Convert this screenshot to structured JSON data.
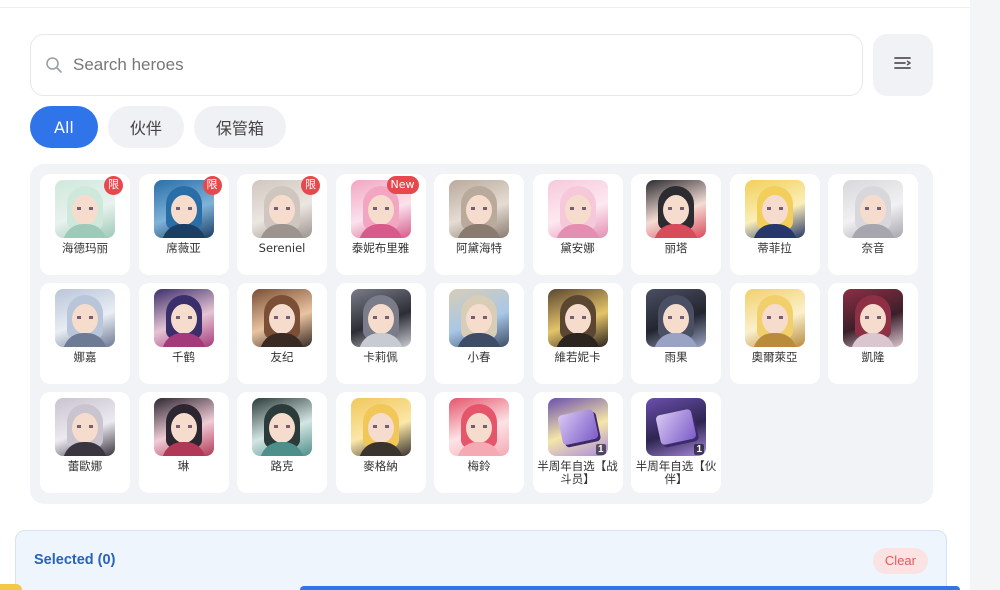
{
  "search": {
    "placeholder": "Search heroes",
    "icon": "search-icon"
  },
  "sort": {
    "icon": "sort-icon"
  },
  "tabs": [
    {
      "label": "All",
      "active": true
    },
    {
      "label": "伙伴",
      "active": false
    },
    {
      "label": "保管箱",
      "active": false
    }
  ],
  "heroes": [
    {
      "name": "海德玛丽",
      "badge": "限",
      "colors": [
        "#cfe8dc",
        "#9fc9b8",
        "#e8f2ee"
      ]
    },
    {
      "name": "席薇亚",
      "badge": "限",
      "colors": [
        "#2a6ea8",
        "#1c3e64",
        "#7fb3d8"
      ]
    },
    {
      "name": "Sereniel",
      "badge": "限",
      "colors": [
        "#cfc7bf",
        "#9d9490",
        "#ece6e1"
      ]
    },
    {
      "name": "泰妮布里雅",
      "badge": "New",
      "colors": [
        "#f2a6c1",
        "#d65b8b",
        "#fbe2ec"
      ]
    },
    {
      "name": "阿黛海特",
      "badge": "",
      "colors": [
        "#b9aa9c",
        "#8a7b70",
        "#e5dcd3"
      ]
    },
    {
      "name": "黛安娜",
      "badge": "",
      "colors": [
        "#f6c9da",
        "#e48eb1",
        "#fde9f0"
      ]
    },
    {
      "name": "丽塔",
      "badge": "",
      "colors": [
        "#2b2b30",
        "#d84b5b",
        "#f4dcd4"
      ]
    },
    {
      "name": "蒂菲拉",
      "badge": "",
      "colors": [
        "#f2cf5a",
        "#27376b",
        "#fbeeb8"
      ]
    },
    {
      "name": "奈音",
      "badge": "",
      "colors": [
        "#d8d8dc",
        "#a7a6ae",
        "#f1f1f3"
      ]
    },
    {
      "name": "娜嘉",
      "badge": "",
      "colors": [
        "#b9c5d9",
        "#6e7b96",
        "#e9edf4"
      ]
    },
    {
      "name": "千鹤",
      "badge": "",
      "colors": [
        "#3b2f6b",
        "#a43a7b",
        "#e6c4d4"
      ]
    },
    {
      "name": "友纪",
      "badge": "",
      "colors": [
        "#7a4f35",
        "#3a2a24",
        "#e9c4a2"
      ]
    },
    {
      "name": "卡莉佩",
      "badge": "",
      "colors": [
        "#7a7d89",
        "#c9cbd2",
        "#2c2d35"
      ]
    },
    {
      "name": "小春",
      "badge": "",
      "colors": [
        "#d8cdb6",
        "#3d4d67",
        "#a8c7e7"
      ]
    },
    {
      "name": "維若妮卡",
      "badge": "",
      "colors": [
        "#5b4632",
        "#2c241e",
        "#e4c46a"
      ]
    },
    {
      "name": "雨果",
      "badge": "",
      "colors": [
        "#4a4f63",
        "#9aa3c4",
        "#23252f"
      ]
    },
    {
      "name": "奧爾萊亞",
      "badge": "",
      "colors": [
        "#f1d06b",
        "#b88c3b",
        "#fbf0cc"
      ]
    },
    {
      "name": "凱隆",
      "badge": "",
      "colors": [
        "#8e2f45",
        "#d9c6cf",
        "#3a1f2a"
      ]
    },
    {
      "name": "蕾歐娜",
      "badge": "",
      "colors": [
        "#c9c4cf",
        "#3a3540",
        "#ece9f0"
      ]
    },
    {
      "name": "琳",
      "badge": "",
      "colors": [
        "#2d2631",
        "#b13856",
        "#f0ccd6"
      ]
    },
    {
      "name": "路克",
      "badge": "",
      "colors": [
        "#2b3b3a",
        "#4f8f8b",
        "#d4e6e3"
      ]
    },
    {
      "name": "麥格納",
      "badge": "",
      "colors": [
        "#f1c75a",
        "#3a332e",
        "#fbe7a8"
      ]
    },
    {
      "name": "梅鈴",
      "badge": "",
      "colors": [
        "#e5556b",
        "#f4a9b3",
        "#fde3e6"
      ]
    }
  ],
  "items": [
    {
      "name": "半周年自选【战斗员】",
      "count": "1",
      "colors": [
        "#6b4fae",
        "#a98bdf",
        "#f5e6a8"
      ]
    },
    {
      "name": "半周年自选【伙伴】",
      "count": "1",
      "colors": [
        "#6b4fae",
        "#a98bdf",
        "#2e2550"
      ]
    }
  ],
  "selected": {
    "title": "Selected (0)",
    "clear_label": "Clear"
  },
  "colors": {
    "accent": "#2f74e9",
    "badge": "#e8474e",
    "panel": "#f2f3f6"
  }
}
